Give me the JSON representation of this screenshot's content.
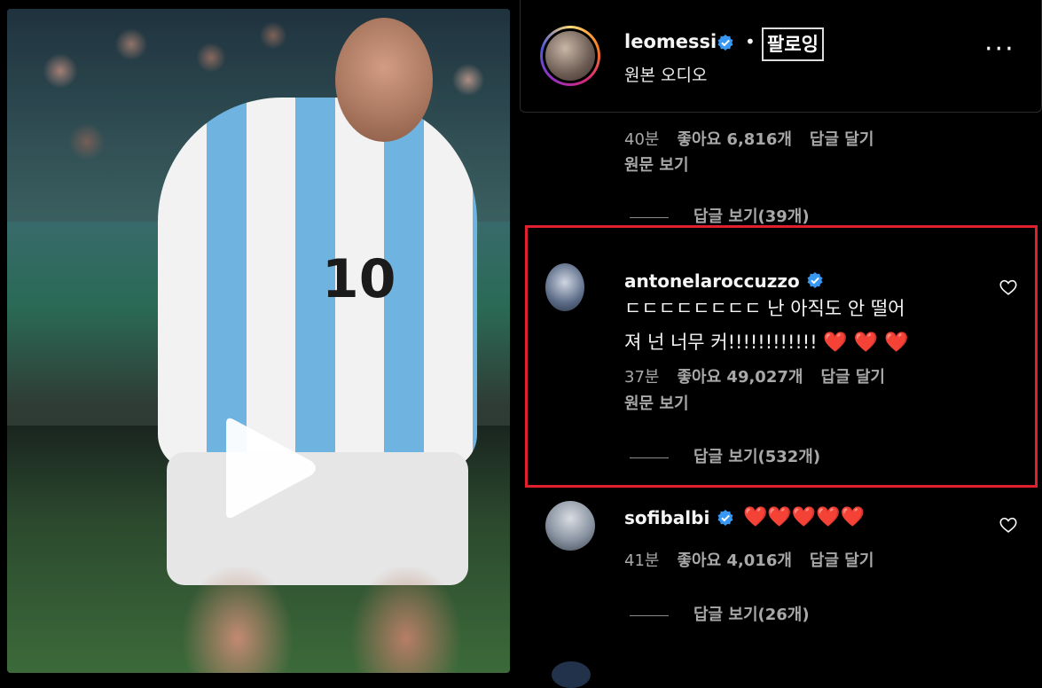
{
  "post": {
    "username": "leomessi",
    "separator": "•",
    "follow_label": "팔로잉",
    "audio_label": "원본 오디오",
    "more_label": "···"
  },
  "comments": [
    {
      "time": "40분",
      "likes": "좋아요 6,816개",
      "reply": "답글 달기",
      "see_original": "원문 보기",
      "view_replies": "답글 보기(39개)"
    },
    {
      "username": "antonelaroccuzzo",
      "text_line1": "ㄷㄷㄷㄷㄷㄷㄷㄷ 난 아직도 안 떨어",
      "text_line2": "져 넌 너무 커!!!!!!!!!!!!",
      "hearts": "❤️ ❤️ ❤️",
      "time": "37분",
      "likes": "좋아요 49,027개",
      "reply": "답글 달기",
      "see_original": "원문 보기",
      "view_replies": "답글 보기(532개)"
    },
    {
      "username": "sofibalbi",
      "hearts": "❤️❤️❤️❤️❤️",
      "time": "41분",
      "likes": "좋아요 4,016개",
      "reply": "답글 달기",
      "view_replies": "답글 보기(26개)"
    }
  ],
  "video": {
    "jersey_number": "10",
    "play_icon": "play-icon"
  },
  "colors": {
    "highlight": "#e0202d",
    "verified": "#3897f0",
    "heart": "#e0241b"
  }
}
